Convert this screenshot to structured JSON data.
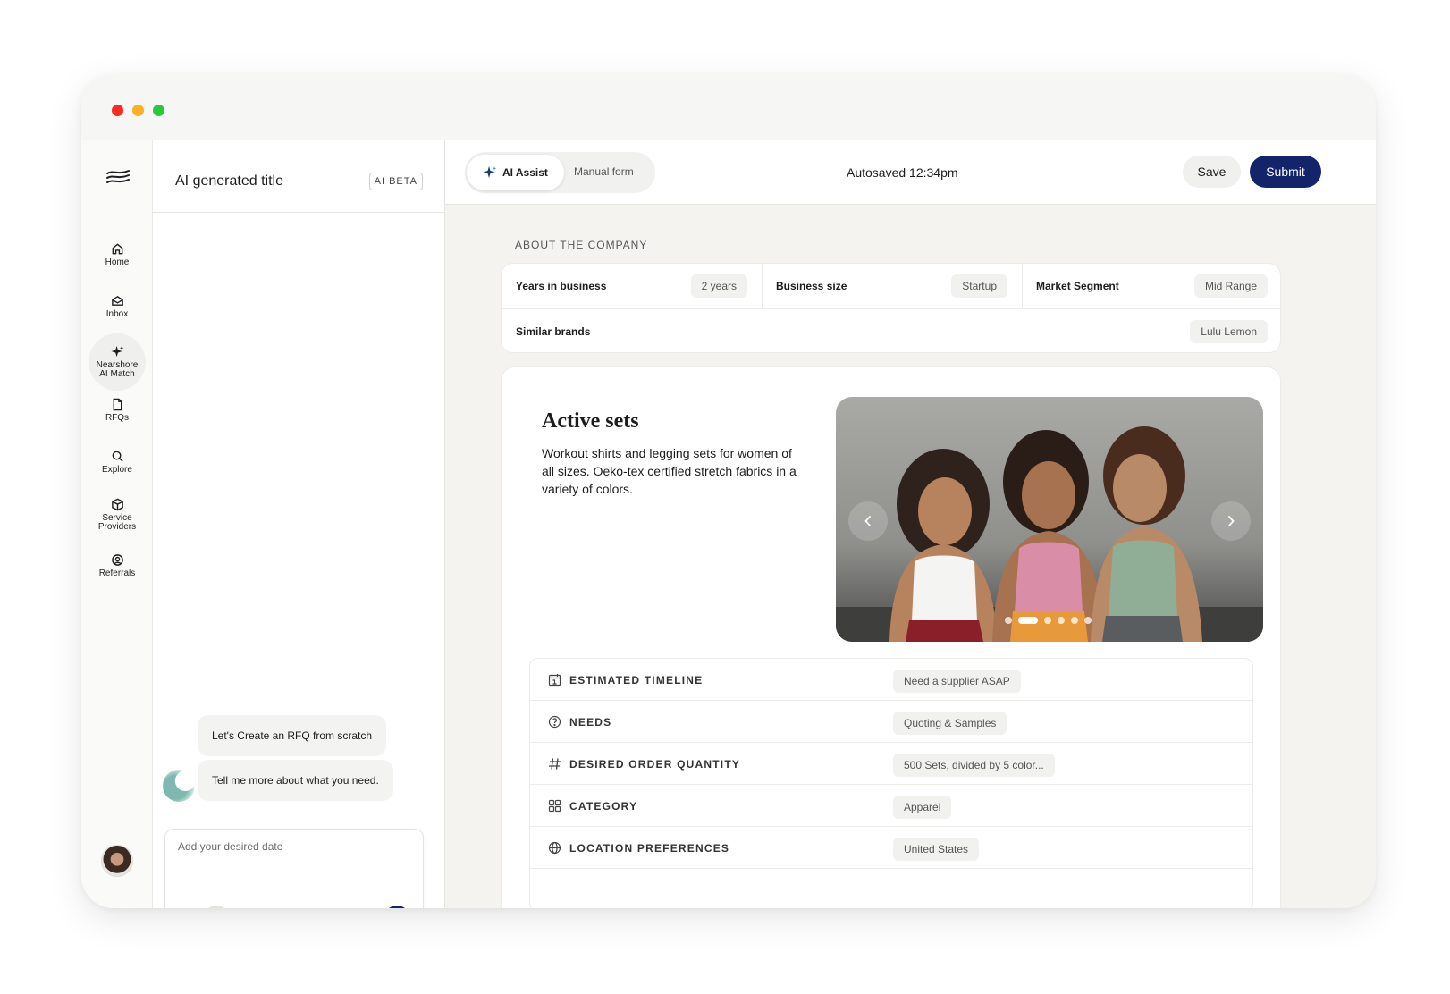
{
  "chat": {
    "title": "AI generated title",
    "badge": "AI BETA",
    "messages": [
      "Let's Create an RFQ from scratch",
      "Tell me more about what you need."
    ],
    "input_placeholder": "Add your desired date"
  },
  "rail": {
    "items": [
      {
        "label": "Home",
        "icon": "home-icon"
      },
      {
        "label": "Inbox",
        "icon": "inbox-icon"
      },
      {
        "label_line1": "Nearshore",
        "label_line2": "AI Match",
        "icon": "sparkle-icon",
        "active": true
      },
      {
        "label": "RFQs",
        "icon": "document-icon"
      },
      {
        "label": "Explore",
        "icon": "search-icon"
      },
      {
        "label_line1": "Service",
        "label_line2": "Providers",
        "icon": "package-icon"
      },
      {
        "label": "Referrals",
        "icon": "referral-icon"
      }
    ]
  },
  "topbar": {
    "tab_ai": "AI Assist",
    "tab_manual": "Manual form",
    "autosave": "Autosaved 12:34pm",
    "save_label": "Save",
    "submit_label": "Submit"
  },
  "company": {
    "section_label": "ABOUT THE COMPANY",
    "fields": [
      {
        "label": "Years in business",
        "value": "2 years"
      },
      {
        "label": "Business size",
        "value": "Startup"
      },
      {
        "label": "Market Segment",
        "value": "Mid Range"
      },
      {
        "label": "Similar brands",
        "value": "Lulu Lemon"
      }
    ]
  },
  "product": {
    "title": "Active sets",
    "description": "Workout shirts and legging sets for women of all sizes. Oeko-tex certified stretch fabrics in a variety of colors.",
    "carousel_slide": 2,
    "carousel_total": 6
  },
  "details": [
    {
      "label": "ESTIMATED TIMELINE",
      "value": "Need a supplier ASAP",
      "icon": "calendar-icon"
    },
    {
      "label": "NEEDS",
      "value": "Quoting & Samples",
      "icon": "question-circle-icon"
    },
    {
      "label": "DESIRED ORDER QUANTITY",
      "value": "500 Sets, divided by 5 color...",
      "icon": "hash-icon"
    },
    {
      "label": "CATEGORY",
      "value": "Apparel",
      "icon": "grid-icon"
    },
    {
      "label": "LOCATION PREFERENCES",
      "value": "United States",
      "icon": "globe-icon"
    }
  ],
  "colors": {
    "primary": "#14246b",
    "chip_bg": "#f1f1ef",
    "traffic_red": "#fe2a1d",
    "traffic_yellow": "#fdb122",
    "traffic_green": "#29c83e"
  }
}
